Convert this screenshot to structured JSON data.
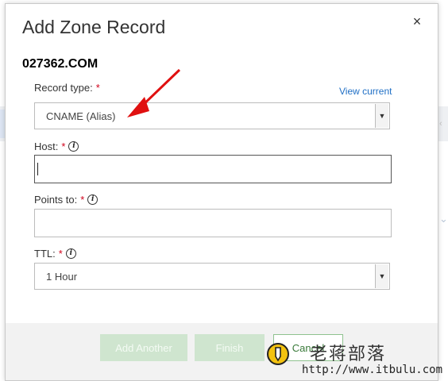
{
  "dialog": {
    "title": "Add Zone Record",
    "domain": "027362.COM",
    "close_label": "×"
  },
  "form": {
    "record_type": {
      "label": "Record type:",
      "required_mark": "*",
      "link": "View current",
      "value": "CNAME (Alias)"
    },
    "host": {
      "label": "Host:",
      "required_mark": "*",
      "value": ""
    },
    "points_to": {
      "label": "Points to:",
      "required_mark": "*",
      "value": ""
    },
    "ttl": {
      "label": "TTL:",
      "required_mark": "*",
      "value": "1 Hour"
    }
  },
  "buttons": {
    "add_another": "Add Another",
    "finish": "Finish",
    "cancel": "Cancel"
  },
  "watermark": {
    "chinese": "老蒋部落",
    "url": "http://www.itbulu.com"
  },
  "colors": {
    "accent_link": "#1f6fc5",
    "required": "#d0021b",
    "arrow": "#e01010",
    "button_disabled": "#cfe5cf"
  },
  "icons": [
    "close-icon",
    "info-icon",
    "dropdown-arrow-icon",
    "annotation-arrow-icon",
    "watermark-logo-icon"
  ]
}
